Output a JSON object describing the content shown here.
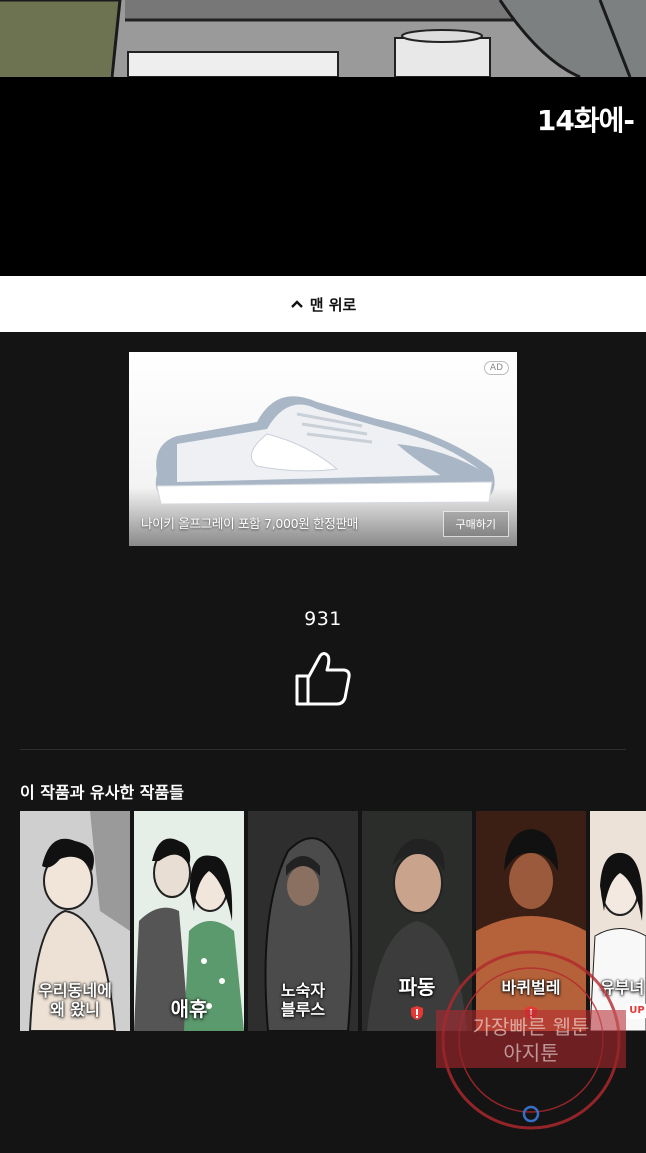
{
  "panel": {
    "caption": "14화에-"
  },
  "top_button": {
    "label": "맨 위로",
    "icon": "chevron-up-icon"
  },
  "ad": {
    "badge": "AD",
    "text": "나이키 올프그레이 포함 7,000원 한정판매",
    "button": "구매하기"
  },
  "like": {
    "count": "931",
    "icon": "thumbs-up-icon"
  },
  "similar": {
    "title": "이 작품과 유사한 작품들",
    "items": [
      {
        "title": "우리동네에\n왜 왔니"
      },
      {
        "title": "애휴"
      },
      {
        "title": "노숙자\n블루스"
      },
      {
        "title": "파동"
      },
      {
        "title": "바퀴벌레"
      },
      {
        "title": "유부녀",
        "badge": "UP"
      }
    ]
  },
  "watermark": {
    "line1": "가장빠른 웹툰",
    "line2": "아지툰"
  },
  "colors": {
    "background": "#141414",
    "top_bar": "#ffffff",
    "accent_red": "#e53935"
  }
}
